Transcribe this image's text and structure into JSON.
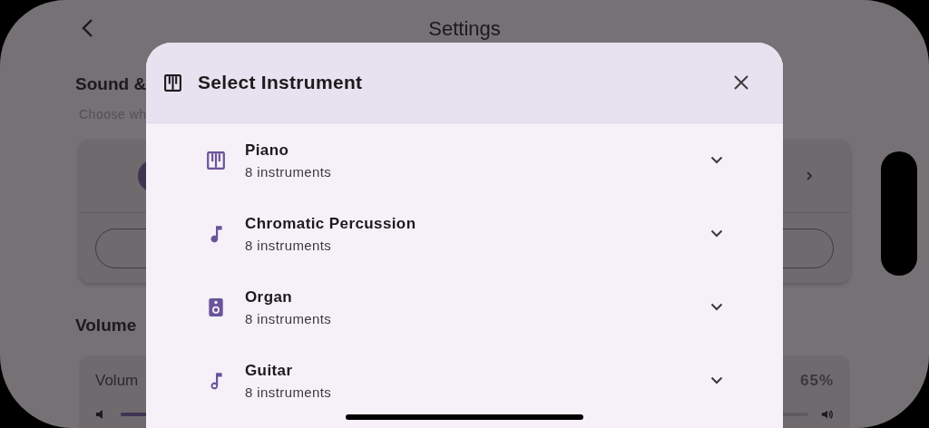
{
  "app_bar": {
    "title": "Settings"
  },
  "background": {
    "section_title": "Sound &",
    "section_hint": "Choose wh",
    "volume_title": "Volume",
    "volume_label": "Volum",
    "volume_reading": "65%",
    "volume_slider": {
      "level": 0.65
    }
  },
  "dialog": {
    "title": "Select Instrument",
    "categories": [
      {
        "kind": "piano",
        "name": "Piano",
        "count": "8 instruments",
        "expanded": false
      },
      {
        "kind": "note",
        "name": "Chromatic Percussion",
        "count": "8 instruments",
        "expanded": false
      },
      {
        "kind": "speaker",
        "name": "Organ",
        "count": "8 instruments",
        "expanded": false
      },
      {
        "kind": "hollow-note",
        "name": "Guitar",
        "count": "8 instruments",
        "expanded": false
      }
    ]
  }
}
